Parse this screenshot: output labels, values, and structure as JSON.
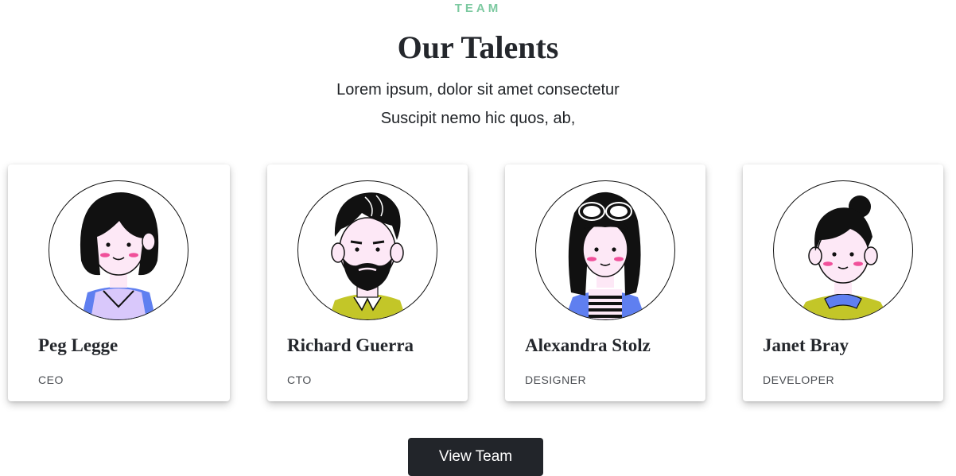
{
  "section": {
    "eyebrow": "TEAM",
    "title": "Our Talents",
    "subtitle_line1": "Lorem ipsum, dolor sit amet consectetur",
    "subtitle_line2": "Suscipit nemo hic quos, ab,"
  },
  "members": [
    {
      "name": "Peg Legge",
      "role": "CEO",
      "avatar_icon": "woman-bob-haircut-avatar-icon"
    },
    {
      "name": "Richard Guerra",
      "role": "CTO",
      "avatar_icon": "bearded-man-avatar-icon"
    },
    {
      "name": "Alexandra Stolz",
      "role": "DESIGNER",
      "avatar_icon": "woman-glasses-long-hair-avatar-icon"
    },
    {
      "name": "Janet Bray",
      "role": "DEVELOPER",
      "avatar_icon": "woman-bun-avatar-icon"
    }
  ],
  "cta": {
    "label": "View Team"
  },
  "colors": {
    "eyebrow": "#7cc9a0",
    "heading": "#24272c",
    "button_bg": "#22252a",
    "skin": "#fde8f6",
    "blush": "#f0509a",
    "accent_blue": "#5f7ff0",
    "accent_lime": "#c3c628",
    "accent_lavender": "#d9c8fb"
  }
}
